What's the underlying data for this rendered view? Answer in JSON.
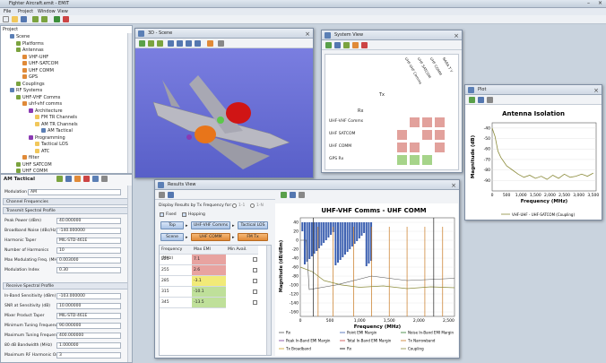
{
  "app": {
    "title": "Fighter Aircraft.emit - EMIT",
    "menu": [
      "File",
      "Project",
      "Window",
      "View"
    ]
  },
  "project": {
    "title": "Project",
    "items": [
      {
        "label": "Scene",
        "indent": 1
      },
      {
        "label": "Platforms",
        "indent": 2
      },
      {
        "label": "Antennas",
        "indent": 2
      },
      {
        "label": "VHF-UHF",
        "indent": 3
      },
      {
        "label": "UHF-SATCOM",
        "indent": 3
      },
      {
        "label": "UHF COMM",
        "indent": 3
      },
      {
        "label": "GPS",
        "indent": 3
      },
      {
        "label": "Couplings",
        "indent": 2
      },
      {
        "label": "RF Systems",
        "indent": 1
      },
      {
        "label": "UHF-VHF Comms",
        "indent": 2
      },
      {
        "label": "uhf-vhf comms",
        "indent": 3
      },
      {
        "label": "Architecture",
        "indent": 4
      },
      {
        "label": "FM TR Channels",
        "indent": 5
      },
      {
        "label": "AM TR Channels",
        "indent": 5
      },
      {
        "label": "AM Tactical",
        "indent": 6
      },
      {
        "label": "Programming",
        "indent": 4
      },
      {
        "label": "Tactical LOS",
        "indent": 5
      },
      {
        "label": "ATC",
        "indent": 5
      },
      {
        "label": "filter",
        "indent": 3
      },
      {
        "label": "UHF SATCOM",
        "indent": 2
      },
      {
        "label": "UHF COMM",
        "indent": 2
      }
    ]
  },
  "props": {
    "title": "AM Tactical",
    "modulation_label": "Modulation",
    "modulation_value": "AM",
    "channel_freq": "Channel Frequencies",
    "transmit_section": "Transmit Spectral Profile",
    "tx_rows": [
      {
        "label": "Peak Power (dBm)",
        "value": "40.000000"
      },
      {
        "label": "Broadband Noise (dBc/Hz)",
        "value": "-140.000000"
      },
      {
        "label": "Harmonic Taper",
        "value": "MIL-STD-461E"
      },
      {
        "label": "Number of Harmonics",
        "value": "10"
      },
      {
        "label": "Max Modulating Freq. (MHz)",
        "value": "0.003000"
      },
      {
        "label": "Modulation Index",
        "value": "0.30"
      }
    ],
    "receive_section": "Receive Spectral Profile",
    "rx_rows": [
      {
        "label": "In-Band Sensitivity (dBm)",
        "value": "-103.000000"
      },
      {
        "label": "SNR at Sensitivity (dB)",
        "value": "10.000000"
      },
      {
        "label": "Mixer Product Taper",
        "value": "MIL-STD-461E"
      },
      {
        "label": "Minimum Tuning Frequency (MHz)",
        "value": "90.000000"
      },
      {
        "label": "Maximum Tuning Frequency (MHz)",
        "value": "400.000000"
      },
      {
        "label": "80 dB Bandwidth (MHz)",
        "value": "1.000000"
      },
      {
        "label": "Maximum RF Harmonic Order",
        "value": "3"
      }
    ]
  },
  "scene": {
    "title": "3D - Scene"
  },
  "system": {
    "title": "System View",
    "tx_label": "Tx",
    "rx_label": "Rx",
    "tx_cols": [
      "UHF-VHF Comms",
      "UHF SATCOM",
      "UHF COMM",
      "NARA T Y"
    ],
    "rx_rows": [
      "UHF-VHF Comms",
      "UHF SATCOM",
      "UHF COMM",
      "GPS Rx"
    ]
  },
  "plot": {
    "title": "Plot",
    "chart_title": "Antenna Isolation",
    "xlabel": "Frequency (MHz)",
    "ylabel": "Magnitude (dB)",
    "legend": "VHF-UHF - UHF-SATCOM (Coupling)"
  },
  "results": {
    "title": "Results View",
    "display_label": "Display Results by Tx Frequency for:",
    "radio1": "1-1",
    "radio2": "1-N",
    "fixed": "Fixed",
    "hopping": "Hopping",
    "btn_top": "Top",
    "btn_uhf_vhf": "UHF-VHF Comms",
    "btn_tactical": "Tactical LOS",
    "btn_scene": "Scene",
    "btn_uhf_comm": "UHF COMM",
    "btn_fm_tx": "FM Tx",
    "col_freq": "Frequency (MHz)",
    "col_max": "Max EMI",
    "col_min": "Min Avail.",
    "rows": [
      {
        "freq": "225",
        "max": "7.1",
        "color": "#e8a3a0"
      },
      {
        "freq": "255",
        "max": "2.6",
        "color": "#e8a3a0"
      },
      {
        "freq": "285",
        "max": "-3.1",
        "color": "#f1ea78"
      },
      {
        "freq": "315",
        "max": "-10.1",
        "color": "#bfe09a"
      },
      {
        "freq": "345",
        "max": "-13.5",
        "color": "#bfe09a"
      }
    ]
  },
  "emi_chart": {
    "title": "UHF-VHF Comms - UHF COMM",
    "xlabel": "Frequency (MHz)",
    "ylabel": "Magnitude (dB/dBm)",
    "legend": [
      "Rx",
      "Point EMI Margin",
      "Noise In-Band EMI Margin",
      "Peak In-Band EMI Margin",
      "Total In-Band EMI Margin",
      "Tx Narrowband",
      "Tx Broadband",
      "Rx",
      "Coupling"
    ]
  },
  "chart_data": [
    {
      "type": "line",
      "title": "Antenna Isolation",
      "xlabel": "Frequency (MHz)",
      "ylabel": "Magnitude (dB)",
      "xlim": [
        0,
        3600
      ],
      "ylim": [
        -100,
        -35
      ],
      "xticks": [
        "0",
        "500",
        "1,000",
        "1,500",
        "2,000",
        "2,500",
        "3,000",
        "3,500"
      ],
      "yticks": [
        "-40",
        "-50",
        "-60",
        "-70",
        "-80",
        "-90"
      ],
      "series": [
        {
          "name": "VHF-UHF - UHF-SATCOM (Coupling)",
          "x": [
            0,
            100,
            200,
            300,
            400,
            500,
            700,
            900,
            1100,
            1300,
            1500,
            1700,
            1900,
            2100,
            2300,
            2500,
            2700,
            2900,
            3100,
            3300,
            3500
          ],
          "y": [
            -40,
            -48,
            -62,
            -68,
            -72,
            -76,
            -80,
            -84,
            -87,
            -85,
            -88,
            -86,
            -89,
            -85,
            -88,
            -84,
            -87,
            -86,
            -84,
            -86,
            -83
          ]
        }
      ]
    },
    {
      "type": "line",
      "title": "UHF-VHF Comms - UHF COMM",
      "xlabel": "Frequency (MHz)",
      "ylabel": "Magnitude (dB/dBm)",
      "xlim": [
        0,
        2600
      ],
      "xticks": [
        "0",
        "500",
        "1,000",
        "1,500",
        "2,000",
        "2,500"
      ],
      "yticks": [
        "40",
        "20",
        "0",
        "-20",
        "-40",
        "-60",
        "-80",
        "-100",
        "-120",
        "-140",
        "-160"
      ],
      "ylim": [
        -170,
        50
      ]
    }
  ],
  "colors": {
    "accent": "#4a6fa5",
    "bg": "#c9d3de"
  }
}
